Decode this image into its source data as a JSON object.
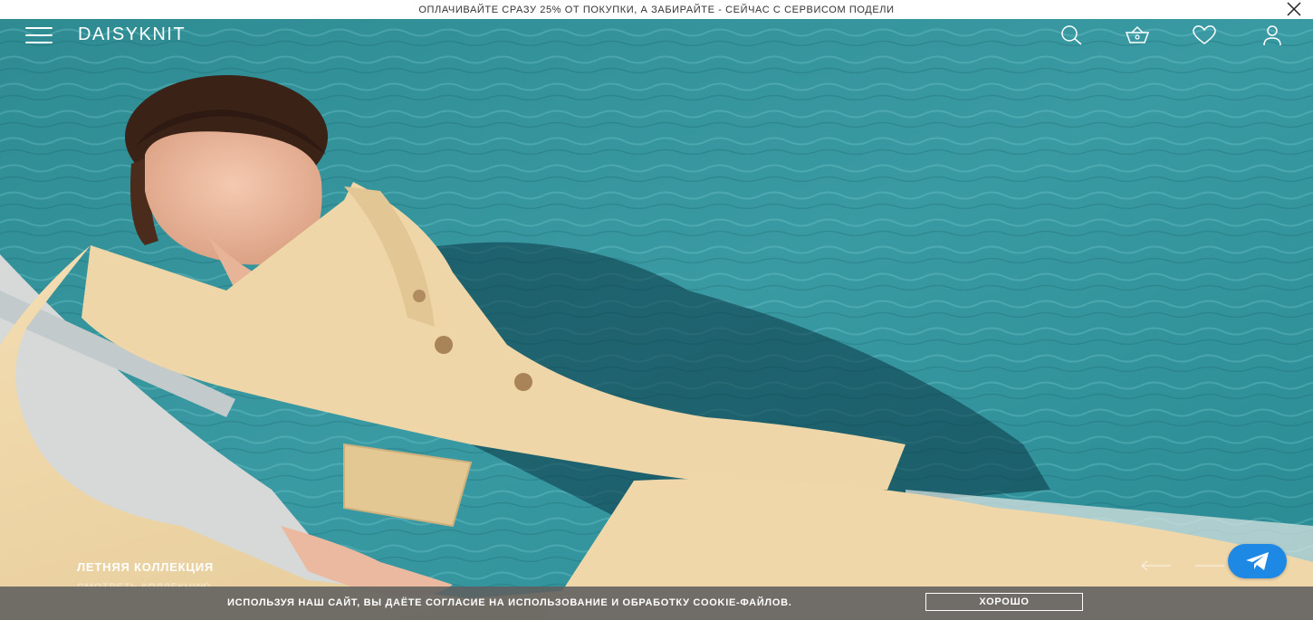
{
  "promo": {
    "text": "ОПЛАЧИВАЙТЕ СРАЗУ 25% ОТ ПОКУПКИ, А ЗАБИРАЙТЕ - СЕЙЧАС С СЕРВИСОМ ПОДЕЛИ"
  },
  "header": {
    "logo": "DAISYKNIT",
    "icons": [
      "menu-icon",
      "search-icon",
      "basket-icon",
      "heart-icon",
      "user-icon"
    ]
  },
  "hero": {
    "caption": "ЛЕТНЯЯ КОЛЛЕКЦИЯ",
    "link": "СМОТРЕТЬ КОЛЛЕКЦИЮ"
  },
  "cookie": {
    "text": "ИСПОЛЬЗУЯ НАШ САЙТ, ВЫ ДАЁТЕ СОГЛАСИЕ НА ИСПОЛЬЗОВАНИЕ И ОБРАБОТКУ COOKIE-ФАЙЛОВ.",
    "button": "ХОРОШО"
  },
  "colors": {
    "pool": "#2f8f97",
    "suit": "#ecd3a3",
    "telegram": "#1e88e5",
    "cookie_bar": "#5f5f5f"
  }
}
